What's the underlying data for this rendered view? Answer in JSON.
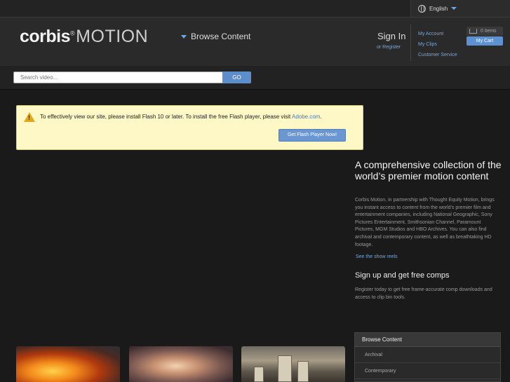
{
  "language": {
    "label": "English"
  },
  "header": {
    "logo_brand": "corbis",
    "logo_registered": "®",
    "logo_product": "MOTION",
    "browse_label": "Browse Content",
    "sign_in": "Sign In",
    "or_register": "or Register",
    "account_links": [
      "My Account",
      "My Clips",
      "Customer Service"
    ],
    "cart_items": "0 items",
    "my_cart": "My Cart"
  },
  "search": {
    "placeholder": "Search video...",
    "go_label": "GO"
  },
  "notice": {
    "text": "To effectively view our site, please install Flash 10 or later. To install the free Flash player, please visit ",
    "link": "Adobe.com",
    "suffix": ".",
    "button": "Get Flash Player Now!"
  },
  "main": {
    "headline": "A comprehensive collection of the world’s premier motion content",
    "description": "Corbis Motion, in partnership with Thought Equity Motion, brings you instant access to content from the world's premier film and entertainment companies, including National Geographic, Sony Pictures Entertainment, Smithsonian Channel, Paramount Pictures, MGM Studios and HBO Archives. You can also find archival and contemporary content, as well as breathtaking HD footage.",
    "show_reels": "See the show reels",
    "signup_heading": "Sign up and get free comps",
    "signup_text": "Register today to get free frame-accurate comp downloads and access to clip bin tools."
  },
  "browse_panel": {
    "title": "Browse Content",
    "items": [
      "Archival",
      "Contemporary"
    ]
  },
  "icons": [
    "globe-icon",
    "dropdown-caret-icon",
    "cart-icon",
    "warning-icon"
  ],
  "colors": {
    "accent": "#5e91d1",
    "link": "#7aa7d8",
    "notice_bg": "#fdf8c6"
  }
}
